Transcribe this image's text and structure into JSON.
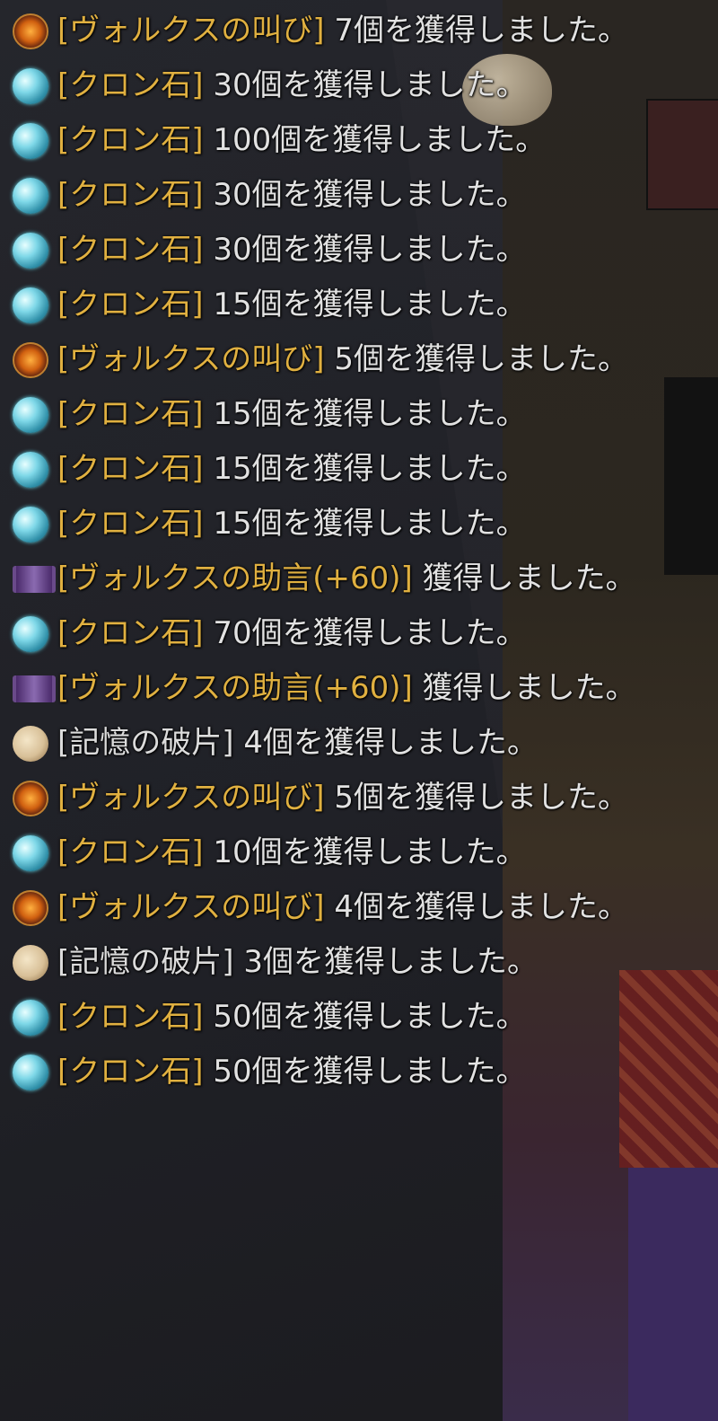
{
  "messages": [
    {
      "icon": "shout-icon",
      "item": "[ヴォルクスの叫び]",
      "item_color": "gold",
      "text": " 7個を獲得しました。"
    },
    {
      "icon": "kron-stone-icon",
      "item": "[クロン石]",
      "item_color": "gold",
      "text": " 30個を獲得しました。"
    },
    {
      "icon": "kron-stone-icon",
      "item": "[クロン石]",
      "item_color": "gold",
      "text": " 100個を獲得しました。"
    },
    {
      "icon": "kron-stone-icon",
      "item": "[クロン石]",
      "item_color": "gold",
      "text": " 30個を獲得しました。"
    },
    {
      "icon": "kron-stone-icon",
      "item": "[クロン石]",
      "item_color": "gold",
      "text": " 30個を獲得しました。"
    },
    {
      "icon": "kron-stone-icon",
      "item": "[クロン石]",
      "item_color": "gold",
      "text": " 15個を獲得しました。"
    },
    {
      "icon": "shout-icon",
      "item": "[ヴォルクスの叫び]",
      "item_color": "gold",
      "text": " 5個を獲得しました。"
    },
    {
      "icon": "kron-stone-icon",
      "item": "[クロン石]",
      "item_color": "gold",
      "text": " 15個を獲得しました。"
    },
    {
      "icon": "kron-stone-icon",
      "item": "[クロン石]",
      "item_color": "gold",
      "text": " 15個を獲得しました。"
    },
    {
      "icon": "kron-stone-icon",
      "item": "[クロン石]",
      "item_color": "gold",
      "text": " 15個を獲得しました。"
    },
    {
      "icon": "advice-scroll-icon",
      "item": "[ヴォルクスの助言(+60)]",
      "item_color": "gold",
      "text": " 獲得しました。"
    },
    {
      "icon": "kron-stone-icon",
      "item": "[クロン石]",
      "item_color": "gold",
      "text": " 70個を獲得しました。"
    },
    {
      "icon": "advice-scroll-icon",
      "item": "[ヴォルクスの助言(+60)]",
      "item_color": "gold",
      "text": " 獲得しました。"
    },
    {
      "icon": "memory-fragment-icon",
      "item": "[記憶の破片]",
      "item_color": "white",
      "text": " 4個を獲得しました。"
    },
    {
      "icon": "shout-icon",
      "item": "[ヴォルクスの叫び]",
      "item_color": "gold",
      "text": " 5個を獲得しました。"
    },
    {
      "icon": "kron-stone-icon",
      "item": "[クロン石]",
      "item_color": "gold",
      "text": " 10個を獲得しました。"
    },
    {
      "icon": "shout-icon",
      "item": "[ヴォルクスの叫び]",
      "item_color": "gold",
      "text": " 4個を獲得しました。"
    },
    {
      "icon": "memory-fragment-icon",
      "item": "[記憶の破片]",
      "item_color": "white",
      "text": " 3個を獲得しました。"
    },
    {
      "icon": "kron-stone-icon",
      "item": "[クロン石]",
      "item_color": "gold",
      "text": " 50個を獲得しました。"
    },
    {
      "icon": "kron-stone-icon",
      "item": "[クロン石]",
      "item_color": "gold",
      "text": " 50個を獲得しました。"
    }
  ],
  "colors": {
    "item_gold": "#e0b040",
    "item_white": "#dcdcdc",
    "text": "#e2e2e2"
  }
}
